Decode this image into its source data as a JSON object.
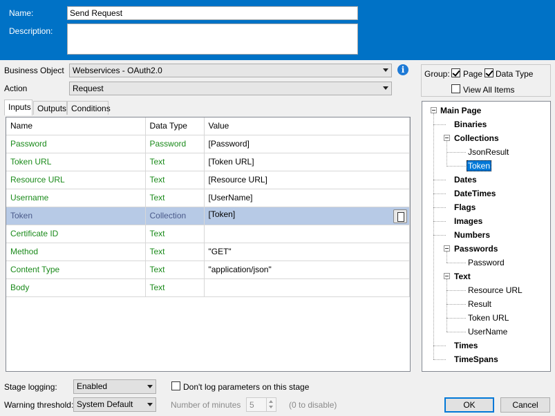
{
  "header": {
    "name_label": "Name:",
    "name_value": "Send Request",
    "description_label": "Description:",
    "description_value": ""
  },
  "form": {
    "business_object_label": "Business Object",
    "business_object_value": "Webservices - OAuth2.0",
    "action_label": "Action",
    "action_value": "Request"
  },
  "tabs": [
    {
      "label": "Inputs"
    },
    {
      "label": "Outputs"
    },
    {
      "label": "Conditions"
    }
  ],
  "grid": {
    "columns": [
      "Name",
      "Data Type",
      "Value"
    ],
    "rows": [
      {
        "name": "Password",
        "type": "Password",
        "value": "[Password]"
      },
      {
        "name": "Token URL",
        "type": "Text",
        "value": "[Token URL]"
      },
      {
        "name": "Resource URL",
        "type": "Text",
        "value": "[Resource URL]"
      },
      {
        "name": "Username",
        "type": "Text",
        "value": "[UserName]"
      },
      {
        "name": "Token",
        "type": "Collection",
        "value": "[Token]"
      },
      {
        "name": "Certificate ID",
        "type": "Text",
        "value": ""
      },
      {
        "name": "Method",
        "type": "Text",
        "value": "\"GET\""
      },
      {
        "name": "Content Type",
        "type": "Text",
        "value": "\"application/json\""
      },
      {
        "name": "Body",
        "type": "Text",
        "value": ""
      }
    ]
  },
  "group": {
    "label": "Group:",
    "page": "Page",
    "data_type": "Data Type",
    "view_all": "View All Items"
  },
  "tree": {
    "root": "Main Page",
    "nodes": [
      "Binaries",
      "Collections",
      "JsonResult",
      "Token",
      "Dates",
      "DateTimes",
      "Flags",
      "Images",
      "Numbers",
      "Passwords",
      "Password",
      "Text",
      "Resource URL",
      "Result",
      "Token URL",
      "UserName",
      "Times",
      "TimeSpans"
    ]
  },
  "footer": {
    "stage_logging_label": "Stage logging:",
    "stage_logging_value": "Enabled",
    "dont_log_label": "Don't log parameters on this stage",
    "warning_label": "Warning threshold:",
    "warning_value": "System Default",
    "minutes_label": "Number of minutes",
    "minutes_value": "5",
    "disable_hint": "(0 to disable)",
    "ok": "OK",
    "cancel": "Cancel"
  },
  "colors": {
    "header": "#0072c6",
    "green": "#1a8a1a",
    "selected_row": "#b7cae6"
  }
}
